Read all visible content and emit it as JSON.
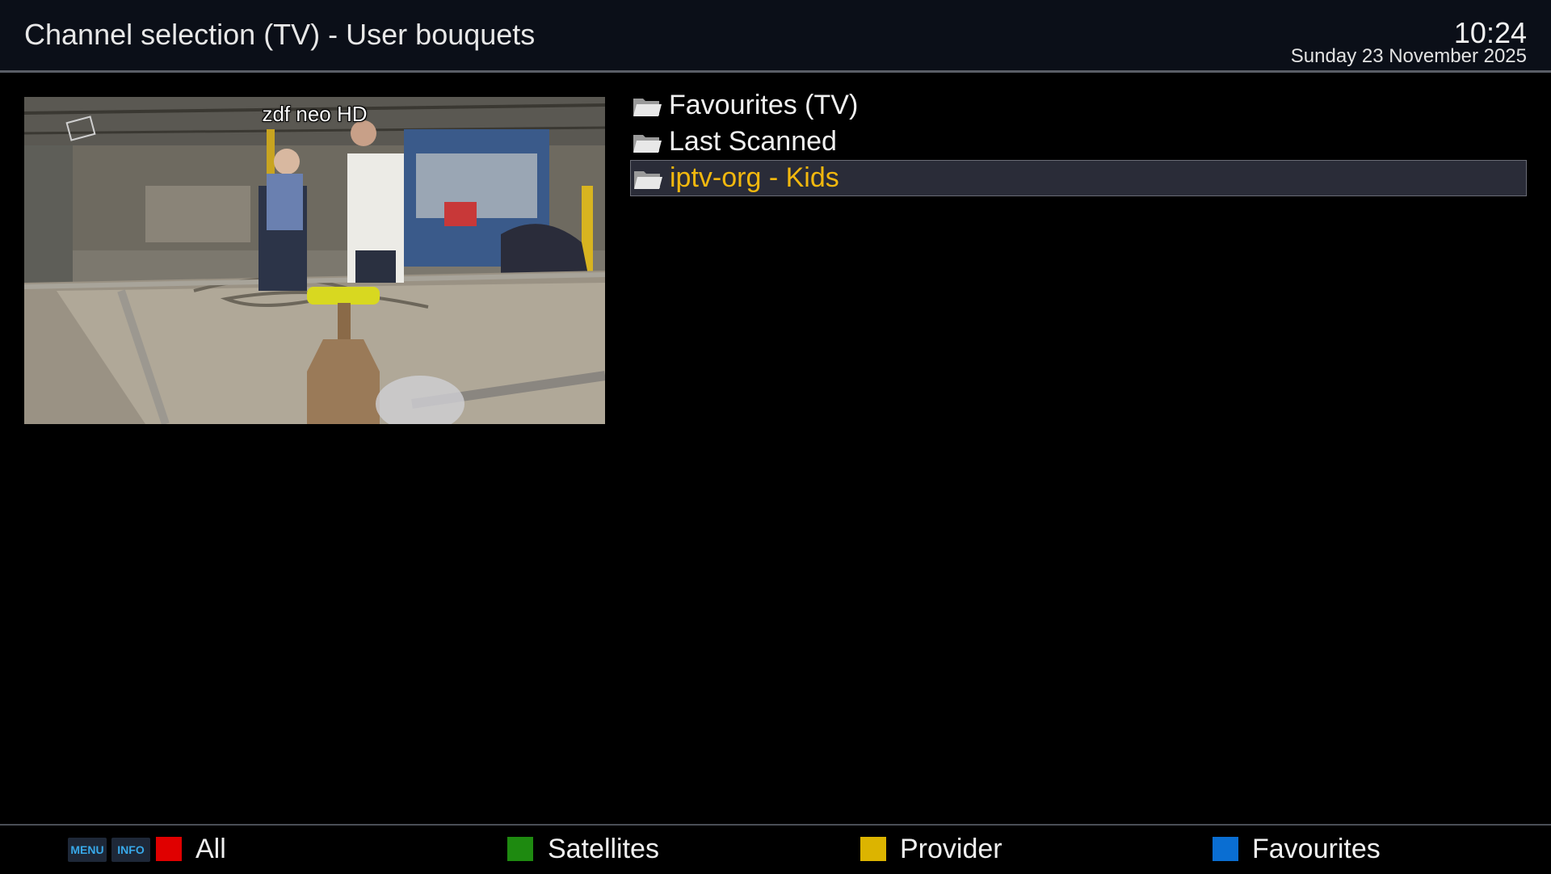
{
  "header": {
    "title": "Channel selection (TV) - User bouquets",
    "time": "10:24",
    "date": "Sunday 23 November 2025"
  },
  "preview": {
    "channel_name": "zdf neo HD"
  },
  "bouquets": [
    {
      "label": "Favourites (TV)",
      "icon": "folder-icon",
      "selected": false
    },
    {
      "label": "Last Scanned",
      "icon": "folder-icon",
      "selected": false
    },
    {
      "label": "iptv-org - Kids",
      "icon": "folder-icon",
      "selected": true
    }
  ],
  "footer": {
    "menu_key": "MENU",
    "info_key": "INFO",
    "buttons": [
      {
        "label": "All",
        "color": "#e00000"
      },
      {
        "label": "Satellites",
        "color": "#1e8a10"
      },
      {
        "label": "Provider",
        "color": "#dcb400"
      },
      {
        "label": "Favourites",
        "color": "#0a6ed2"
      }
    ]
  },
  "colors": {
    "accent_selected_text": "#f2b80e",
    "selection_background": "#2a2c38",
    "header_background": "#0b0f18"
  }
}
